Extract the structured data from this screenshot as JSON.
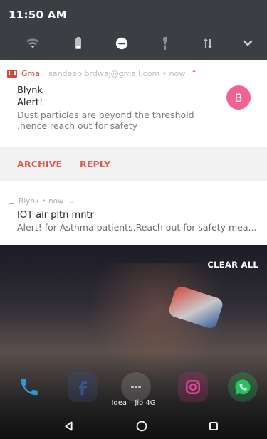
{
  "status_bar": {
    "time": "11:50 AM"
  },
  "quick_settings": {
    "icons": [
      "wifi-off-icon",
      "battery-icon",
      "dnd-icon",
      "flashlight-icon",
      "data-transfer-icon",
      "chevron-down-icon"
    ]
  },
  "gmail_notification": {
    "app": "Gmail",
    "meta": "sandeep.brdwaj@gmail.com • now",
    "title": "Blynk",
    "subject": "Alert!",
    "body": "Dust particles are beyond the threshold ,hence reach out for safety",
    "avatar_letter": "B",
    "colors": {
      "accent": "#d64a3a",
      "avatar": "#f06292"
    }
  },
  "actions": {
    "archive": "ARCHIVE",
    "reply": "REPLY",
    "color": "#e5574a"
  },
  "blynk_notification": {
    "header": "Blynk • now",
    "title": "IOT air pltn mntr",
    "body": "Alert! for Asthma patients.Reach out for safety mea..."
  },
  "wallpaper": {
    "clear_all": "CLEAR ALL",
    "carrier": "Idea – Jio 4G"
  },
  "dock": {
    "apps": [
      {
        "name": "phone",
        "color": "#2aa6e6"
      },
      {
        "name": "facebook",
        "color": "#3b5998"
      },
      {
        "name": "apps-drawer",
        "color": "#9e9e9e"
      },
      {
        "name": "instagram",
        "color": "#c13584"
      },
      {
        "name": "whatsapp",
        "color": "#25d366"
      }
    ]
  },
  "navbar": {
    "items": [
      "back-icon",
      "home-icon",
      "recents-icon"
    ]
  }
}
